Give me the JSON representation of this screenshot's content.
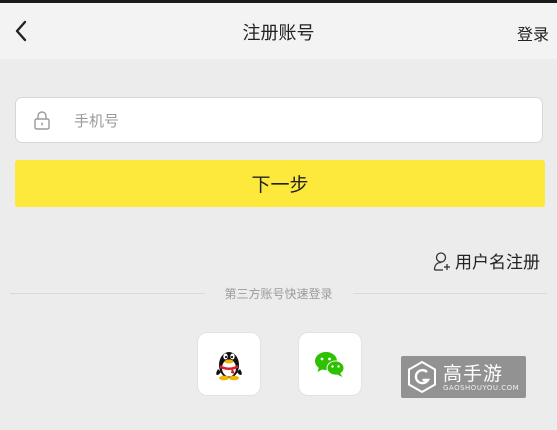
{
  "header": {
    "title": "注册账号",
    "login_label": "登录",
    "back_icon": "chevron-left-icon"
  },
  "phone": {
    "placeholder": "手机号",
    "value": "",
    "icon": "lock-icon"
  },
  "next_button": {
    "label": "下一步"
  },
  "username_register": {
    "label": "用户名注册",
    "icon": "user-add-icon"
  },
  "third_party": {
    "divider_label": "第三方账号快速登录",
    "providers": [
      {
        "name": "qq",
        "icon": "qq-penguin-icon"
      },
      {
        "name": "wechat",
        "icon": "wechat-icon"
      }
    ]
  },
  "watermark": {
    "title": "高手游",
    "subtitle": "GAOSHOUYOU.COM"
  },
  "colors": {
    "accent": "#fde93c",
    "background": "#ececec",
    "header_bg": "#f3f3f3",
    "wechat_green": "#2dc100",
    "qq_red": "#d8202a"
  }
}
